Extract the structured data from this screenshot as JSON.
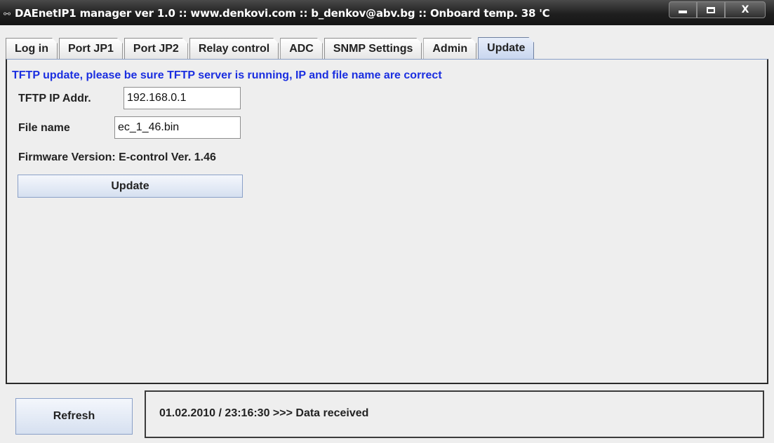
{
  "window": {
    "title": "DAEnetIP1 manager ver 1.0 :: www.denkovi.com :: b_denkov@abv.bg :: Onboard temp. 38 'C",
    "icon": "link-icon",
    "controls": {
      "minimize": "minimize-icon",
      "maximize": "maximize-icon",
      "close_label": "X"
    }
  },
  "tabs": [
    {
      "label": "Log in"
    },
    {
      "label": "Port JP1"
    },
    {
      "label": "Port JP2"
    },
    {
      "label": "Relay control"
    },
    {
      "label": "ADC"
    },
    {
      "label": "SNMP Settings"
    },
    {
      "label": "Admin"
    },
    {
      "label": "Update",
      "active": true
    }
  ],
  "update_panel": {
    "heading": "TFTP update, please be sure TFTP server is running, IP and file name are correct",
    "tftp_ip": {
      "label": "TFTP IP Addr.",
      "value": "192.168.0.1"
    },
    "file_name": {
      "label": "File name",
      "value": "ec_1_46.bin"
    },
    "firmware_version": "Firmware Version: E-control Ver. 1.46",
    "update_button": "Update"
  },
  "footer": {
    "refresh_button": "Refresh",
    "status": "01.02.2010 / 23:16:30 >>> Data received"
  },
  "colors": {
    "heading": "#1a2ee0",
    "titlebar": "#1f1f1f",
    "background": "#eeeeee"
  }
}
